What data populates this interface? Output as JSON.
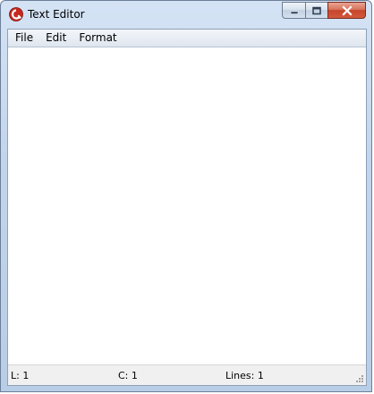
{
  "window": {
    "title": "Text Editor",
    "icon": "red-swirl-app-icon",
    "accent_color": "#d9735b",
    "frame_color": "#c3d5ec"
  },
  "caption_buttons": {
    "minimize_icon": "minimize-icon",
    "maximize_icon": "maximize-icon",
    "close_icon": "close-icon"
  },
  "menu": {
    "items": [
      {
        "label": "File"
      },
      {
        "label": "Edit"
      },
      {
        "label": "Format"
      }
    ]
  },
  "editor": {
    "content": ""
  },
  "status": {
    "line": "L: 1",
    "column": "C: 1",
    "lines": "Lines: 1"
  }
}
